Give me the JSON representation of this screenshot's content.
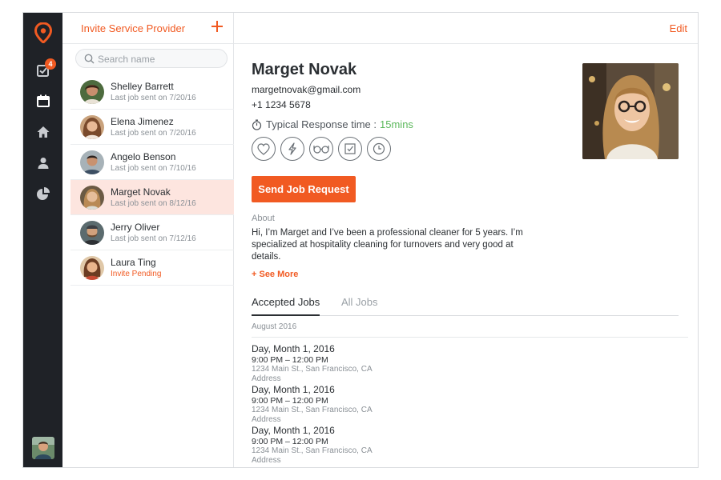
{
  "rail": {
    "badge_count": "4",
    "icons": [
      "location-pin-icon",
      "tasks-icon",
      "calendar-icon",
      "home-icon",
      "person-icon",
      "pie-chart-icon"
    ]
  },
  "list": {
    "title": "Invite Service Provider",
    "search_placeholder": "Search name",
    "contacts": [
      {
        "name": "Shelley Barrett",
        "sub": "Last job sent on 7/20/16"
      },
      {
        "name": "Elena Jimenez",
        "sub": "Last job sent on 7/20/16"
      },
      {
        "name": "Angelo Benson",
        "sub": "Last job sent on 7/10/16"
      },
      {
        "name": "Marget Novak",
        "sub": "Last job sent on 8/12/16"
      },
      {
        "name": "Jerry Oliver",
        "sub": "Last job sent on 7/12/16"
      },
      {
        "name": "Laura Ting",
        "sub": "Invite Pending"
      }
    ]
  },
  "detail": {
    "edit_label": "Edit",
    "name": "Marget Novak",
    "email": "margetnovak@gmail.com",
    "phone": "+1 1234 5678",
    "response_label": "Typical Response time :",
    "response_value": "15mins",
    "send_button": "Send Job Request",
    "about_label": "About",
    "about_text": "Hi, I’m Marget and I’ve been a professional cleaner for 5 years. I’m specialized at hospitality cleaning for turnovers and very good at details.",
    "see_more": "+ See More",
    "tabs": [
      "Accepted Jobs",
      "All Jobs"
    ],
    "month": "August 2016",
    "jobs": [
      {
        "date": "Day, Month 1, 2016",
        "time": "9:00 PM – 12:00 PM",
        "address": "1234 Main St., San Francisco, CA",
        "address2": "Address"
      },
      {
        "date": "Day, Month 1, 2016",
        "time": "9:00 PM – 12:00 PM",
        "address": "1234 Main St., San Francisco, CA",
        "address2": "Address"
      },
      {
        "date": "Day, Month 1, 2016",
        "time": "9:00 PM – 12:00 PM",
        "address": "1234 Main St., San Francisco, CA",
        "address2": "Address"
      }
    ]
  },
  "colors": {
    "accent": "#f15a22",
    "rail": "#1f2227",
    "active_row": "#fde5df",
    "response_green": "#5cb85c"
  }
}
